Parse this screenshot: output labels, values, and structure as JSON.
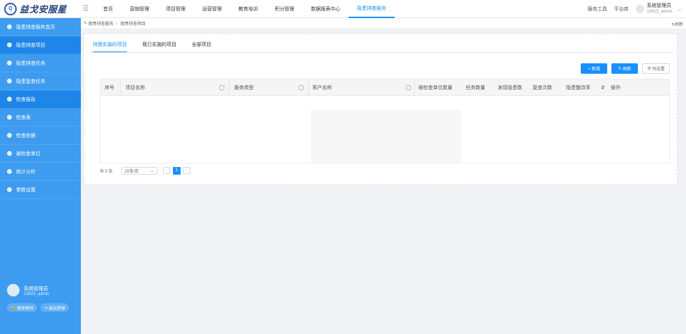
{
  "brand": {
    "logo_text": "Q",
    "name": "益戈安服星"
  },
  "nav": {
    "items": [
      "首页",
      "营销管理",
      "项目管理",
      "运营管理",
      "教育培训",
      "积分管理",
      "数据报表中心",
      "隐患排查服务"
    ],
    "active_index": 7
  },
  "top_right": {
    "service_tool": "服务工具",
    "platform": "平台库",
    "user_name": "系统管理员",
    "user_id": "19823_admin"
  },
  "sidebar": {
    "items": [
      {
        "label": "隐患排查服务首页"
      },
      {
        "label": "隐患排查项目"
      },
      {
        "label": "隐患排查任务"
      },
      {
        "label": "隐患复查任务"
      },
      {
        "label": "检查报告"
      },
      {
        "label": "检查表"
      },
      {
        "label": "检查依据"
      },
      {
        "label": "被检查单位"
      },
      {
        "label": "统计分析"
      },
      {
        "label": "参数设置"
      }
    ],
    "active_index": 1,
    "user": {
      "name": "系统管理员",
      "id": "19823_admin",
      "change_password": "修改密码",
      "logout": "退出登录"
    }
  },
  "breadcrumb": {
    "items": [
      "隐患排查服务",
      "隐患排查项目"
    ],
    "refresh": "刷新"
  },
  "tabs": {
    "items": [
      "待我实施的项目",
      "我已实施的项目",
      "全部项目"
    ],
    "active_index": 0
  },
  "toolbar": {
    "add_label": "+ 新增",
    "refresh_label": "刷新",
    "columns_label": "列设置"
  },
  "table": {
    "columns": [
      "序号",
      "项目名称",
      "服务类型",
      "客户名称",
      "被检查单位数量",
      "任务数量",
      "发现隐患数",
      "复查次数",
      "隐患整改率",
      "操作"
    ],
    "rows": []
  },
  "pager": {
    "total_text": "共 0 条",
    "page_size": "20条/页",
    "current_page": "1"
  },
  "colors": {
    "primary": "#1890ff",
    "sidebar": "#3d9cf0",
    "sidebar_active": "#1e86e8"
  }
}
